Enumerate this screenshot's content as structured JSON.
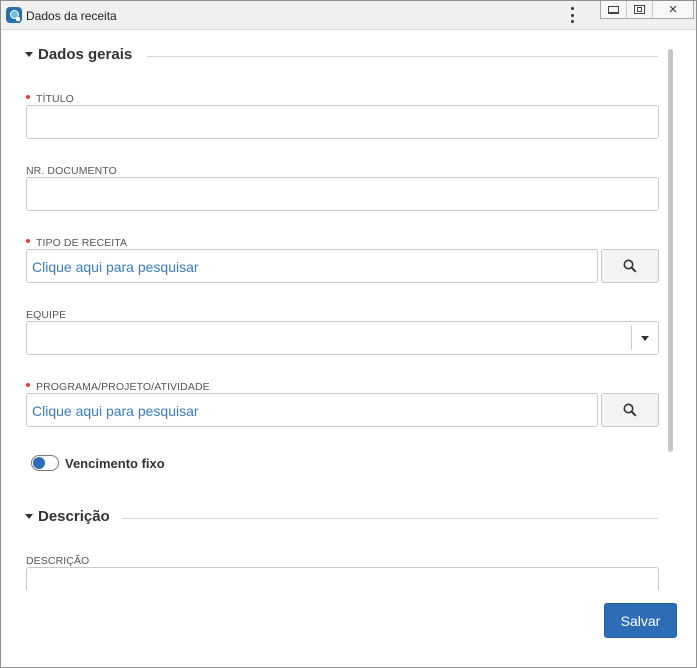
{
  "window": {
    "title": "Dados da receita",
    "controls": [
      "minimize-icon",
      "maximize-icon",
      "close-icon"
    ],
    "close_glyph": "✕"
  },
  "sections": {
    "general": {
      "title": "Dados gerais"
    },
    "description": {
      "title": "Descrição"
    }
  },
  "fields": {
    "titulo": {
      "label": "TÍTULO",
      "required": true,
      "value": ""
    },
    "nr_documento": {
      "label": "NR. DOCUMENTO",
      "required": false,
      "value": ""
    },
    "tipo_receita": {
      "label": "TIPO DE RECEITA",
      "required": true,
      "placeholder": "Clique aqui para pesquisar"
    },
    "equipe": {
      "label": "EQUIPE",
      "required": false,
      "value": ""
    },
    "programa": {
      "label": "PROGRAMA/PROJETO/ATIVIDADE",
      "required": true,
      "placeholder": "Clique aqui para pesquisar"
    },
    "vencimento_fixo": {
      "label": "Vencimento fixo",
      "on": true
    },
    "descricao": {
      "label": "DESCRIÇÃO",
      "value": ""
    }
  },
  "actions": {
    "save_label": "Salvar"
  },
  "colors": {
    "accent": "#2d6db5",
    "link": "#3a7dbf",
    "required": "#e23b3b"
  }
}
